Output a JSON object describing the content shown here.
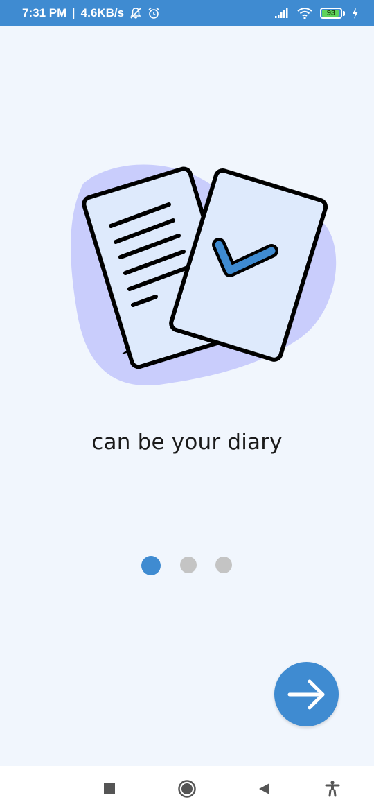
{
  "status_bar": {
    "time": "7:31 PM",
    "separator": "|",
    "net_speed": "4.6KB/s",
    "icons": [
      "notifications-off-icon",
      "alarm-icon",
      "signal-icon",
      "wifi-icon"
    ],
    "battery_level": "93",
    "charging_icon": "bolt-icon"
  },
  "onboarding": {
    "illustration": "documents-checklist-illustration",
    "caption": "can be your diary",
    "pages_total": 3,
    "current_page": 1,
    "next_icon": "arrow-right-icon"
  },
  "nav_bar": {
    "buttons": [
      "recents-icon",
      "home-icon",
      "back-icon",
      "accessibility-icon"
    ]
  },
  "colors": {
    "primary": "#3f8bd1",
    "background": "#f1f6fd",
    "blob": "#c9cdfc",
    "paper": "#deeafc",
    "dot_inactive": "#c4c4c4"
  }
}
